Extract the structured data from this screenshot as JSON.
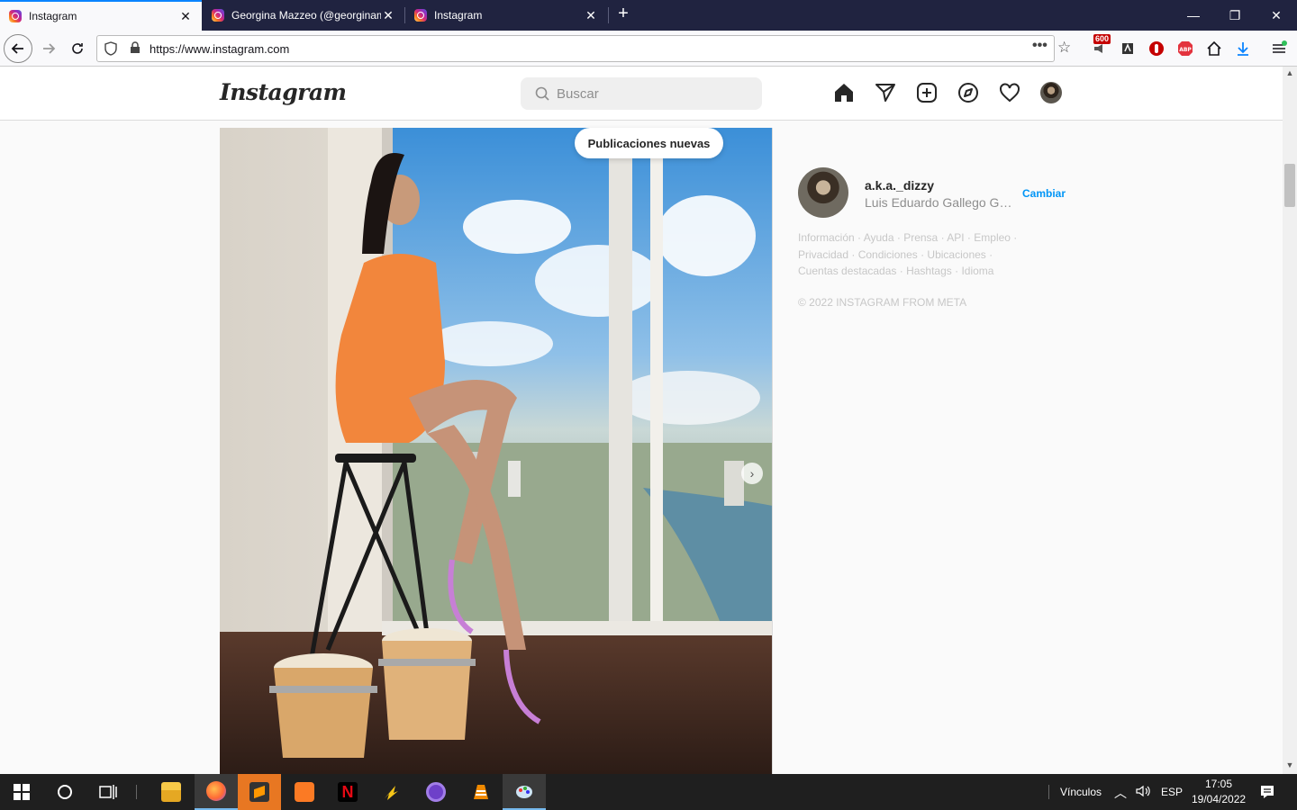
{
  "browser": {
    "tabs": [
      {
        "label": "Instagram",
        "active": true
      },
      {
        "label": "Georgina Mazzeo (@georginam",
        "active": false
      },
      {
        "label": "Instagram",
        "active": false
      }
    ],
    "url": "https://www.instagram.com",
    "extension_badge": "600"
  },
  "instagram": {
    "logo": "Instagram",
    "search_placeholder": "Buscar",
    "new_posts_label": "Publicaciones nuevas",
    "sidebar": {
      "username": "a.k.a._dizzy",
      "full_name": "Luis Eduardo Gallego Gar...",
      "switch_label": "Cambiar",
      "footer_links": [
        "Información",
        "Ayuda",
        "Prensa",
        "API",
        "Empleo",
        "Privacidad",
        "Condiciones",
        "Ubicaciones",
        "Cuentas destacadas",
        "Hashtags",
        "Idioma"
      ],
      "copyright": "© 2022 INSTAGRAM FROM META"
    }
  },
  "taskbar": {
    "toolbar_label": "Vínculos",
    "language": "ESP",
    "time": "17:05",
    "date": "19/04/2022"
  },
  "colors": {
    "tabstrip": "#202340",
    "accent_blue": "#0095f6",
    "taskbar": "#1f1f1f"
  }
}
